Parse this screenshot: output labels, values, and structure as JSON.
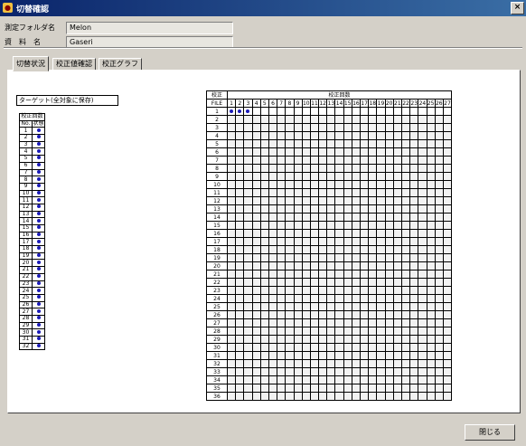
{
  "window": {
    "title": "切替確認",
    "close_glyph": "×"
  },
  "info": {
    "folder_label": "測定フォルダ名",
    "folder_value": "Melon",
    "sample_label": "資　料　名",
    "sample_value": "Gaseri"
  },
  "tabs": [
    {
      "label": "切替状況",
      "active": true
    },
    {
      "label": "校正値確認",
      "active": false
    },
    {
      "label": "校正グラフ",
      "active": false
    }
  ],
  "target_button": "ターゲット(全対象に保存)",
  "left_table": {
    "header_top": "校正回数",
    "col_no": "No.",
    "col_status": "状態",
    "rows": [
      "1",
      "2",
      "3",
      "4",
      "5",
      "6",
      "7",
      "8",
      "9",
      "10",
      "11",
      "12",
      "13",
      "14",
      "15",
      "16",
      "17",
      "18",
      "19",
      "20",
      "21",
      "22",
      "23",
      "24",
      "25",
      "26",
      "27",
      "28",
      "29",
      "30",
      "31",
      "32"
    ]
  },
  "right_table": {
    "header_left_top": "校正",
    "header_left_bottom": "FILE",
    "header_main": "校正回数",
    "columns": [
      "1",
      "2",
      "3",
      "4",
      "5",
      "6",
      "7",
      "8",
      "9",
      "10",
      "11",
      "12",
      "13",
      "14",
      "15",
      "16",
      "17",
      "18",
      "19",
      "20",
      "21",
      "22",
      "23",
      "24",
      "25",
      "26",
      "27"
    ],
    "rows": [
      "1",
      "2",
      "3",
      "4",
      "5",
      "6",
      "7",
      "8",
      "9",
      "10",
      "11",
      "12",
      "13",
      "14",
      "15",
      "16",
      "17",
      "18",
      "19",
      "20",
      "21",
      "22",
      "23",
      "24",
      "25",
      "26",
      "27",
      "28",
      "29",
      "30",
      "31",
      "32",
      "33",
      "34",
      "35",
      "36"
    ],
    "marked_row": "1",
    "marked_columns": 3
  },
  "close_button": "閉じる",
  "colors": {
    "dot": "#1a1ab8",
    "title_start": "#0a246a",
    "title_end": "#3a6ea5"
  }
}
